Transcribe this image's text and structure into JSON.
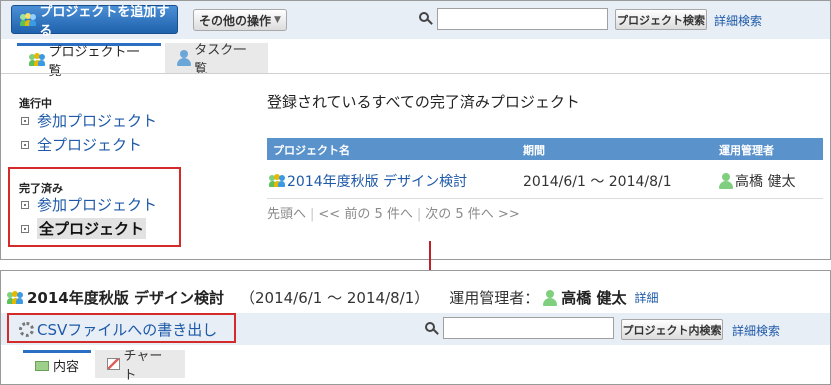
{
  "top": {
    "add_project_label": "プロジェクトを追加する",
    "other_ops_label": "その他の操作",
    "search_button_label": "プロジェクト検索",
    "detail_search_label": "詳細検索",
    "search_value": ""
  },
  "tabs": [
    {
      "label": "プロジェクト一覧"
    },
    {
      "label": "タスク一覧"
    }
  ],
  "sidebar": {
    "in_progress_heading": "進行中",
    "in_progress_items": [
      "参加プロジェクト",
      "全プロジェクト"
    ],
    "done_heading": "完了済み",
    "done_items": [
      "参加プロジェクト",
      "全プロジェクト"
    ]
  },
  "main": {
    "title": "登録されているすべての完了済みプロジェクト",
    "columns": [
      "プロジェクト名",
      "期間",
      "運用管理者"
    ],
    "row": {
      "name": "2014年度秋版 デザイン検討",
      "period": "2014/6/1 ～ 2014/8/1",
      "manager": "高橋 健太"
    },
    "pager": {
      "first": "先頭へ",
      "prev": "<< 前の 5 件へ",
      "next": "次の 5 件へ >>"
    }
  },
  "detail": {
    "project_name": "2014年度秋版 デザイン検討",
    "period": "（2014/6/1 ～ 2014/8/1）",
    "manager_label": "運用管理者：",
    "manager_name": "高橋 健太",
    "detail_link": "詳細",
    "csv_export_label": "CSVファイルへの書き出し",
    "search_button_label": "プロジェクト内検索",
    "detail_search_label": "詳細検索",
    "search_value": "",
    "tabs": [
      {
        "label": "内容"
      },
      {
        "label": "チャート"
      }
    ]
  },
  "colors": {
    "accent_blue": "#1e5aa8",
    "header_blue": "#5a93cc",
    "highlight_red": "#d42a2a"
  }
}
